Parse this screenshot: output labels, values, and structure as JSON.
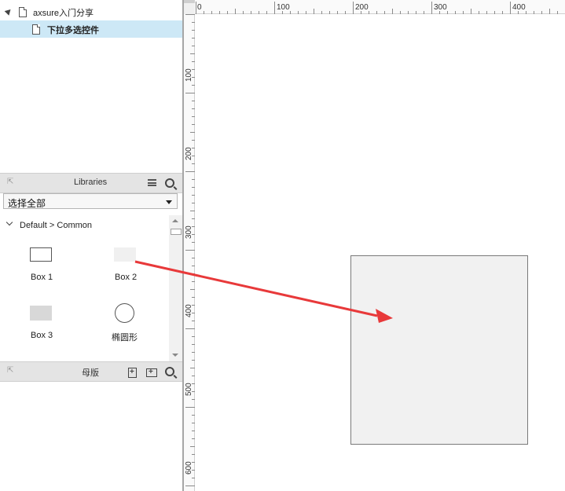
{
  "pages": {
    "root_label": "axsure入门分享",
    "child_label": "下拉多选控件"
  },
  "libraries": {
    "title": "Libraries",
    "selected_library": "选择全部",
    "group_label": "Default > Common",
    "widgets": [
      {
        "label": "Box 1"
      },
      {
        "label": "Box 2"
      },
      {
        "label": "Box 3"
      },
      {
        "label": "椭圆形"
      }
    ]
  },
  "masters": {
    "title": "母版"
  },
  "rulers": {
    "horizontal_labels": [
      "0",
      "100",
      "200",
      "300",
      "400"
    ],
    "vertical_labels": [
      "100",
      "200",
      "300",
      "400",
      "500",
      "600"
    ]
  },
  "annotation": {
    "arrow_color": "#e8393a"
  },
  "colors": {
    "selected_row": "#cde8f6",
    "panel_header": "#e4e4e4"
  }
}
